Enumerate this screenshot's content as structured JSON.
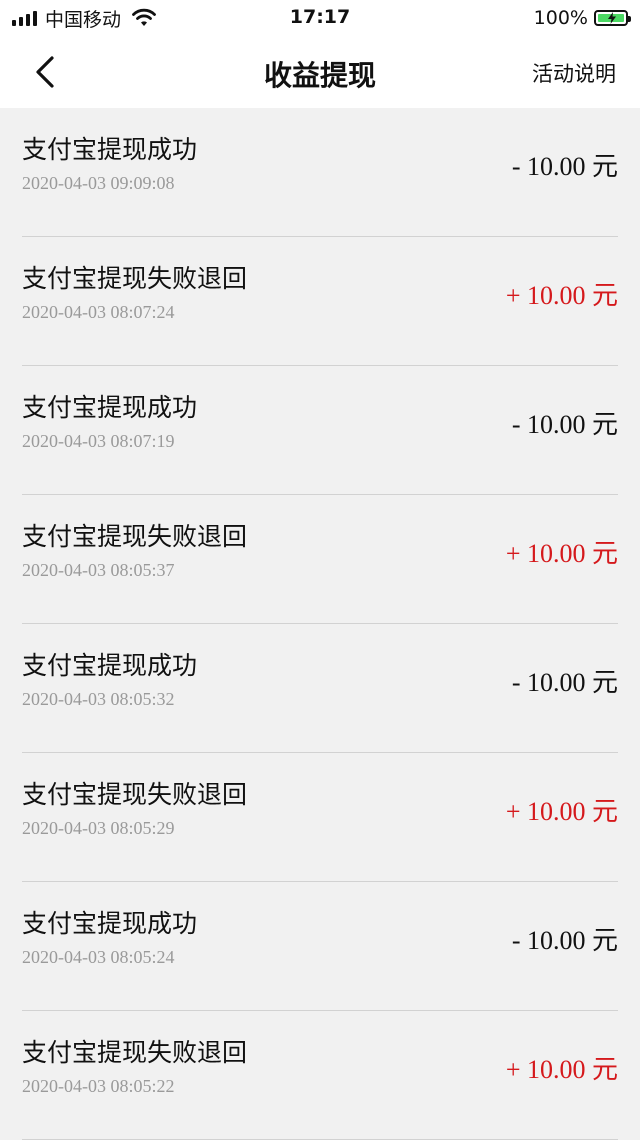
{
  "status_bar": {
    "carrier": "中国移动",
    "time": "17:17",
    "battery": "100%"
  },
  "nav": {
    "title": "收益提现",
    "action": "活动说明"
  },
  "records": [
    {
      "title": "支付宝提现成功",
      "time": "2020-04-03 09:09:08",
      "amount": "- 10.00 元",
      "type": "neg"
    },
    {
      "title": "支付宝提现失败退回",
      "time": "2020-04-03 08:07:24",
      "amount": "+ 10.00 元",
      "type": "pos"
    },
    {
      "title": "支付宝提现成功",
      "time": "2020-04-03 08:07:19",
      "amount": "- 10.00 元",
      "type": "neg"
    },
    {
      "title": "支付宝提现失败退回",
      "time": "2020-04-03 08:05:37",
      "amount": "+ 10.00 元",
      "type": "pos"
    },
    {
      "title": "支付宝提现成功",
      "time": "2020-04-03 08:05:32",
      "amount": "- 10.00 元",
      "type": "neg"
    },
    {
      "title": "支付宝提现失败退回",
      "time": "2020-04-03 08:05:29",
      "amount": "+ 10.00 元",
      "type": "pos"
    },
    {
      "title": "支付宝提现成功",
      "time": "2020-04-03 08:05:24",
      "amount": "- 10.00 元",
      "type": "neg"
    },
    {
      "title": "支付宝提现失败退回",
      "time": "2020-04-03 08:05:22",
      "amount": "+ 10.00 元",
      "type": "pos"
    }
  ],
  "colors": {
    "positive": "#d5191c",
    "negative": "#111111",
    "battery": "#4cd964"
  }
}
